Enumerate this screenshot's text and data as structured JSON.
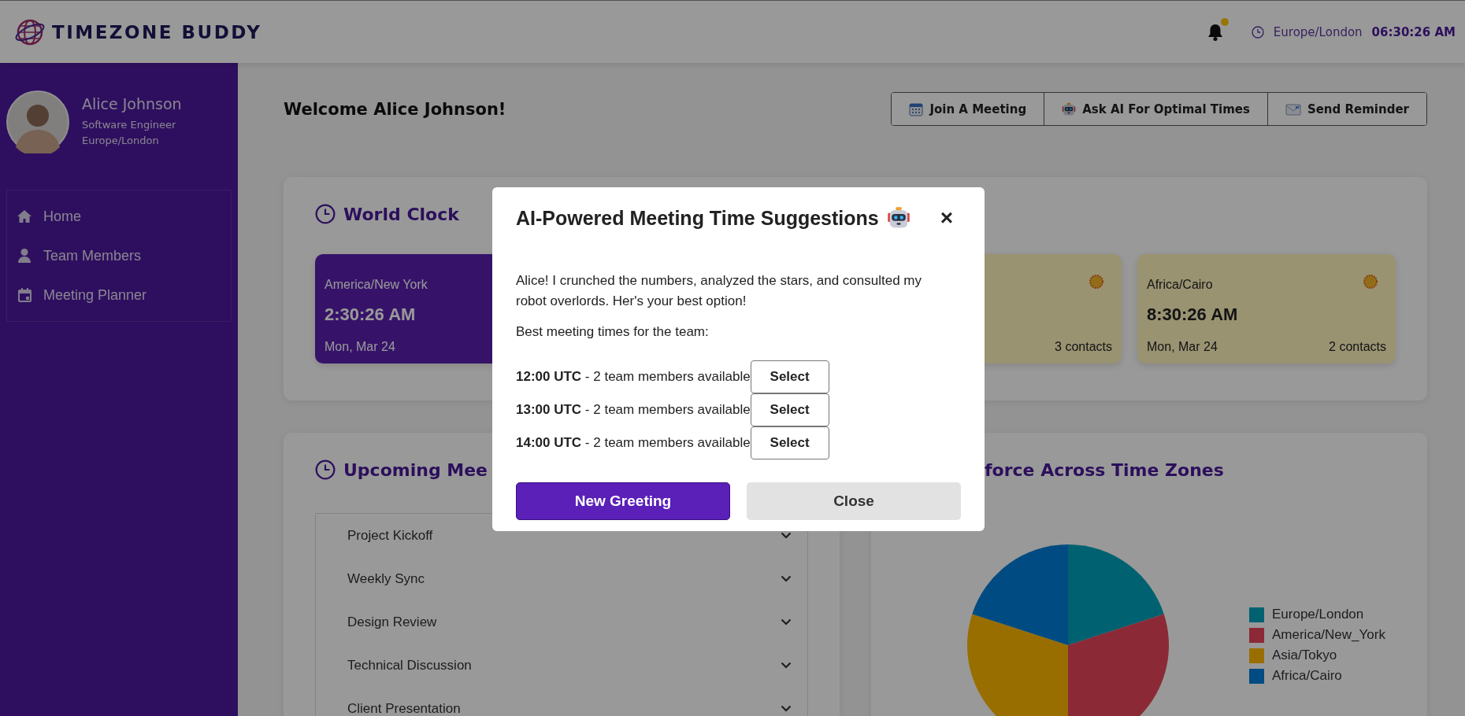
{
  "header": {
    "logo": "TIMEZONE BUDDY",
    "has_notifications": true,
    "timezone": "Europe/London",
    "time": "06:30:26 AM"
  },
  "sidebar": {
    "user": {
      "name": "Alice Johnson",
      "role": "Software Engineer",
      "timezone": "Europe/London"
    },
    "nav": [
      {
        "label": "Home",
        "kind": "home"
      },
      {
        "label": "Team Members",
        "kind": "person"
      },
      {
        "label": "Meeting Planner",
        "kind": "calendar"
      }
    ]
  },
  "welcome": "Welcome Alice Johnson!",
  "actions": [
    {
      "label": "Join A Meeting",
      "kind": "calendar"
    },
    {
      "label": "Ask AI For Optimal Times",
      "kind": "robot"
    },
    {
      "label": "Send Reminder",
      "kind": "envelope"
    }
  ],
  "world_clock": {
    "title": "World Clock",
    "cards": [
      {
        "kind": "night",
        "zone": "America/New York",
        "time": "2:30:26 AM",
        "date": "Mon, Mar 24"
      },
      {
        "kind": "day",
        "contacts": "3 contacts"
      },
      {
        "kind": "day",
        "zone": "Africa/Cairo",
        "time": "8:30:26 AM",
        "date": "Mon, Mar 24",
        "contacts": "2 contacts"
      }
    ]
  },
  "meetings": {
    "title": "Upcoming Mee",
    "items": [
      {
        "title": "Project Kickoff"
      },
      {
        "title": "Weekly Sync"
      },
      {
        "title": "Design Review"
      },
      {
        "title": "Technical Discussion"
      },
      {
        "title": "Client Presentation"
      }
    ]
  },
  "workforce": {
    "title": "force Across Time Zones",
    "chart_data": {
      "type": "pie",
      "categories": [
        "Europe/London",
        "America/New_York",
        "Asia/Tokyo",
        "Africa/Cairo"
      ],
      "values": [
        20,
        30,
        30,
        20
      ],
      "legend": "right",
      "colors": [
        "#00a2bc",
        "#e8475a",
        "#ffb700",
        "#007dd8"
      ]
    }
  },
  "modal": {
    "title": "AI-Powered Meeting Time Suggestions",
    "close": "×",
    "message": "Alice! I crunched the numbers, analyzed the stars, and consulted my robot overlords. Her's your best option!",
    "subtitle": "Best meeting times for the team:",
    "slots": [
      {
        "text": "**12:00 UTC** - 2 team members available",
        "button": "Select"
      },
      {
        "text": "**13:00 UTC** - 2 team members available",
        "button": "Select"
      },
      {
        "text": "**14:00 UTC** - 2 team members available",
        "button": "Select"
      }
    ],
    "buttons": [
      {
        "label": "New Greeting",
        "kind": "primary"
      },
      {
        "label": "Close",
        "kind": "secondary"
      }
    ]
  }
}
